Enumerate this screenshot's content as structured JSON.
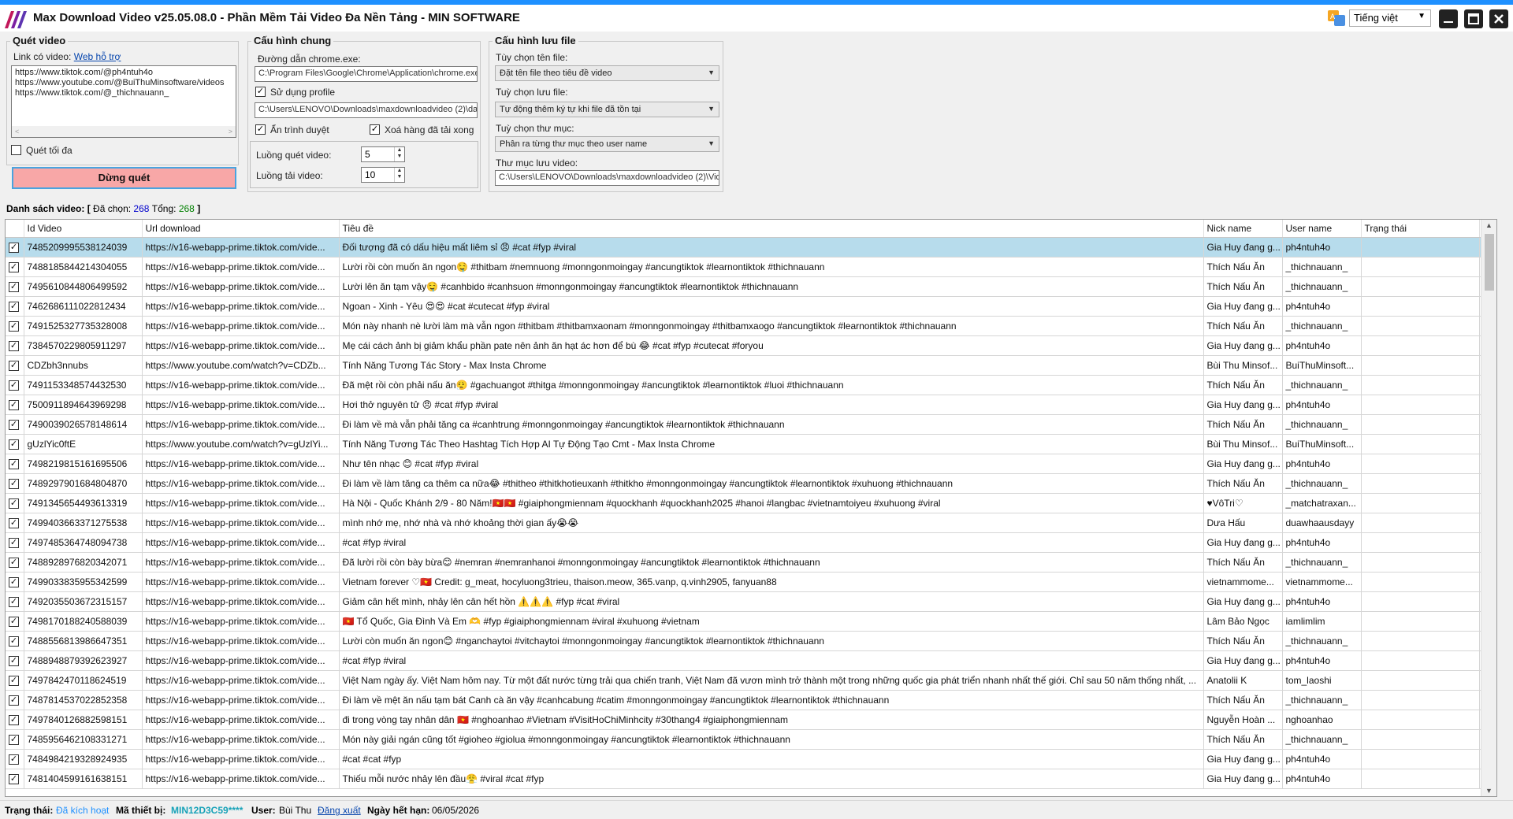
{
  "app": {
    "title": "Max Download Video v25.05.08.0 -  Phần Mềm Tải Video Đa Nền Tảng - MIN SOFTWARE",
    "language": "Tiếng việt"
  },
  "scan": {
    "title": "Quét video",
    "link_label": "Link có video:",
    "help_link": "Web hỗ trợ",
    "links": [
      "https://www.tiktok.com/@ph4ntuh4o",
      "https://www.youtube.com/@BuiThuMinsoftware/videos",
      "https://www.tiktok.com/@_thichnauann_"
    ],
    "max_scan_label": "Quét tối đa",
    "stop_button": "Dừng quét"
  },
  "general": {
    "title": "Cấu hình chung",
    "chrome_path_label": "Đường dẫn chrome.exe:",
    "chrome_path": "C:\\Program Files\\Google\\Chrome\\Application\\chrome.exe",
    "use_profile_label": "Sử dụng profile",
    "profile_path": "C:\\Users\\LENOVO\\Downloads\\maxdownloadvideo (2)\\dat",
    "hide_browser_label": "Ẩn trình duyệt",
    "delete_rows_label": "Xoá hàng đã tải xong",
    "scan_threads_label": "Luồng quét video:",
    "scan_threads": "5",
    "download_threads_label": "Luồng tải video:",
    "download_threads": "10"
  },
  "save": {
    "title": "Cấu hình lưu file",
    "filename_label": "Tùy chọn tên file:",
    "filename_value": "Đặt tên file theo tiêu đề video",
    "savefile_label": "Tuỳ chọn lưu file:",
    "savefile_value": "Tự động thêm ký tự khi file đã tồn tại",
    "folder_option_label": "Tuỳ chọn thư mục:",
    "folder_option_value": "Phân ra từng thư mục theo user name",
    "folder_label": "Thư mục lưu video:",
    "folder_value": "C:\\Users\\LENOVO\\Downloads\\maxdownloadvideo (2)\\Vid"
  },
  "list": {
    "label": "Danh sách video:",
    "open": "[",
    "selected_label": "Đã chọn:",
    "selected": "268",
    "total_label": "Tổng:",
    "total": "268",
    "close": "]"
  },
  "columns": {
    "id": "Id Video",
    "url": "Url download",
    "title": "Tiêu đề",
    "nick": "Nick name",
    "user": "User name",
    "status": "Trạng thái"
  },
  "rows": [
    {
      "id": "7485209995538124039",
      "url": "https://v16-webapp-prime.tiktok.com/vide...",
      "title": "Đối tượng đã có dấu hiệu mất liêm sỉ 😠 #cat #fyp #viral",
      "nick": "Gia Huy đang g...",
      "user": "ph4ntuh4o"
    },
    {
      "id": "7488185844214304055",
      "url": "https://v16-webapp-prime.tiktok.com/vide...",
      "title": "Lười rồi còn muốn ăn ngon🤤 #thitbam #nemnuong #monngonmoingay #ancungtiktok #learnontiktok #thichnauann",
      "nick": "Thích Nấu Ăn",
      "user": "_thichnauann_"
    },
    {
      "id": "7495610844806499592",
      "url": "https://v16-webapp-prime.tiktok.com/vide...",
      "title": "Lười lên ăn tạm vậy🤤 #canhbido #canhsuon #monngonmoingay #ancungtiktok #learnontiktok #thichnauann",
      "nick": "Thích Nấu Ăn",
      "user": "_thichnauann_"
    },
    {
      "id": "7462686111022812434",
      "url": "https://v16-webapp-prime.tiktok.com/vide...",
      "title": "Ngoan - Xinh - Yêu 😍😍 #cat #cutecat #fyp #viral",
      "nick": "Gia Huy đang g...",
      "user": "ph4ntuh4o"
    },
    {
      "id": "7491525327735328008",
      "url": "https://v16-webapp-prime.tiktok.com/vide...",
      "title": "Món này nhanh nè lười làm mà vẫn ngon #thitbam #thitbamxaonam #monngonmoingay #thitbamxaogo #ancungtiktok #learnontiktok #thichnauann",
      "nick": "Thích Nấu Ăn",
      "user": "_thichnauann_"
    },
    {
      "id": "7384570229805911297",
      "url": "https://v16-webapp-prime.tiktok.com/vide...",
      "title": "Mẹ cái cách ảnh bị giảm khẩu phần pate nên ảnh ăn hạt ác hơn để bù 😂 #cat #fyp #cutecat #foryou",
      "nick": "Gia Huy đang g...",
      "user": "ph4ntuh4o"
    },
    {
      "id": "CDZbh3nnubs",
      "url": "https://www.youtube.com/watch?v=CDZb...",
      "title": "Tính Năng Tương Tác Story - Max Insta Chrome",
      "nick": "Bùi Thu Minsof...",
      "user": "BuiThuMinsoft..."
    },
    {
      "id": "7491153348574432530",
      "url": "https://v16-webapp-prime.tiktok.com/vide...",
      "title": "Đã mệt rồi còn phải nấu ăn😮‍💨 #gachuangot #thitga #monngonmoingay #ancungtiktok #learnontiktok #luoi #thichnauann",
      "nick": "Thích Nấu Ăn",
      "user": "_thichnauann_"
    },
    {
      "id": "7500911894643969298",
      "url": "https://v16-webapp-prime.tiktok.com/vide...",
      "title": "Hơi thở nguyên tử 😠 #cat #fyp #viral",
      "nick": "Gia Huy đang g...",
      "user": "ph4ntuh4o"
    },
    {
      "id": "7490039026578148614",
      "url": "https://v16-webapp-prime.tiktok.com/vide...",
      "title": "Đi làm về mà vẫn phải tăng ca #canhtrung #monngonmoingay #ancungtiktok #learnontiktok #thichnauann",
      "nick": "Thích Nấu Ăn",
      "user": "_thichnauann_"
    },
    {
      "id": "gUzlYic0ftE",
      "url": "https://www.youtube.com/watch?v=gUzlYi...",
      "title": "Tính Năng Tương Tác Theo Hashtag Tích Hợp AI Tự Động Tạo Cmt - Max Insta Chrome",
      "nick": "Bùi Thu Minsof...",
      "user": "BuiThuMinsoft..."
    },
    {
      "id": "7498219815161695506",
      "url": "https://v16-webapp-prime.tiktok.com/vide...",
      "title": "Như tên nhạc 😊 #cat #fyp #viral",
      "nick": "Gia Huy đang g...",
      "user": "ph4ntuh4o"
    },
    {
      "id": "7489297901684804870",
      "url": "https://v16-webapp-prime.tiktok.com/vide...",
      "title": "Đi làm về làm tăng ca thêm ca nữa😂 #thitheo #thitkhotieuxanh #thitkho #monngonmoingay #ancungtiktok #learnontiktok #xuhuong #thichnauann",
      "nick": "Thích Nấu Ăn",
      "user": "_thichnauann_"
    },
    {
      "id": "7491345654493613319",
      "url": "https://v16-webapp-prime.tiktok.com/vide...",
      "title": "Hà Nội - Quốc Khánh 2/9 - 80 Năm!🇻🇳🇻🇳 #giaiphongmiennam #quockhanh #quockhanh2025 #hanoi #langbac #vietnamtoiyeu #xuhuong #viral",
      "nick": "♥VôTri♡",
      "user": "_matchatraxan..."
    },
    {
      "id": "7499403663371275538",
      "url": "https://v16-webapp-prime.tiktok.com/vide...",
      "title": "mình nhớ mẹ, nhớ nhà và nhớ khoảng thời gian ấy😭😭",
      "nick": "Dưa Hấu",
      "user": "duawhaausdayy"
    },
    {
      "id": "7497485364748094738",
      "url": "https://v16-webapp-prime.tiktok.com/vide...",
      "title": "#cat #fyp #viral",
      "nick": "Gia Huy đang g...",
      "user": "ph4ntuh4o"
    },
    {
      "id": "7488928976820342071",
      "url": "https://v16-webapp-prime.tiktok.com/vide...",
      "title": "Đã lười rồi còn bày bừa😊 #nemran #nemranhanoi #monngonmoingay #ancungtiktok #learnontiktok #thichnauann",
      "nick": "Thích Nấu Ăn",
      "user": "_thichnauann_"
    },
    {
      "id": "7499033835955342599",
      "url": "https://v16-webapp-prime.tiktok.com/vide...",
      "title": "Vietnam forever ♡🇻🇳 Credit: g_meat, hocyluong3trieu, thaison.meow, 365.vanp, q.vinh2905, fanyuan88",
      "nick": "vietnammome...",
      "user": "vietnammome..."
    },
    {
      "id": "7492035503672315157",
      "url": "https://v16-webapp-prime.tiktok.com/vide...",
      "title": "Giảm cân hết mình, nhảy lên cân hết hồn ⚠️⚠️⚠️ #fyp #cat #viral",
      "nick": "Gia Huy đang g...",
      "user": "ph4ntuh4o"
    },
    {
      "id": "7498170188240588039",
      "url": "https://v16-webapp-prime.tiktok.com/vide...",
      "title": "🇻🇳 Tổ Quốc, Gia Đình Và Em 🫶 #fyp #giaiphongmiennam #viral #xuhuong #vietnam",
      "nick": "Lâm Bảo Ngọc",
      "user": "iamlimlim"
    },
    {
      "id": "7488556813986647351",
      "url": "https://v16-webapp-prime.tiktok.com/vide...",
      "title": "Lười còn muốn ăn ngon😊 #nganchaytoi #vitchaytoi #monngonmoingay #ancungtiktok #learnontiktok #thichnauann",
      "nick": "Thích Nấu Ăn",
      "user": "_thichnauann_"
    },
    {
      "id": "7488948879392623927",
      "url": "https://v16-webapp-prime.tiktok.com/vide...",
      "title": "#cat #fyp #viral",
      "nick": "Gia Huy đang g...",
      "user": "ph4ntuh4o"
    },
    {
      "id": "7497842470118624519",
      "url": "https://v16-webapp-prime.tiktok.com/vide...",
      "title": "Việt Nam ngày ấy. Việt Nam hôm nay. Từ một đất nước từng trải qua chiến tranh, Việt Nam đã vươn mình trở thành một trong những quốc gia phát triển nhanh nhất thế giới. Chỉ sau 50 năm thống nhất, ...",
      "nick": "Anatolii K",
      "user": "tom_laoshi"
    },
    {
      "id": "7487814537022852358",
      "url": "https://v16-webapp-prime.tiktok.com/vide...",
      "title": "Đi làm về mệt ăn nấu tạm bát Canh cà ăn vậy #canhcabung #catim #monngonmoingay #ancungtiktok #learnontiktok #thichnauann",
      "nick": "Thích Nấu Ăn",
      "user": "_thichnauann_"
    },
    {
      "id": "7497840126882598151",
      "url": "https://v16-webapp-prime.tiktok.com/vide...",
      "title": "đi trong vòng tay nhân dân 🇻🇳 #nghoanhao #Vietnam #VisitHoChiMinhcity #30thang4 #giaiphongmiennam",
      "nick": "Nguyễn Hoàn ...",
      "user": "nghoanhao"
    },
    {
      "id": "7485956462108331271",
      "url": "https://v16-webapp-prime.tiktok.com/vide...",
      "title": "Món này giải ngán cũng tốt #gioheo #giolua #monngonmoingay #ancungtiktok #learnontiktok #thichnauann",
      "nick": "Thích Nấu Ăn",
      "user": "_thichnauann_"
    },
    {
      "id": "7484984219328924935",
      "url": "https://v16-webapp-prime.tiktok.com/vide...",
      "title": "#cat #cat #fyp",
      "nick": "Gia Huy đang g...",
      "user": "ph4ntuh4o"
    },
    {
      "id": "7481404599161638151",
      "url": "https://v16-webapp-prime.tiktok.com/vide...",
      "title": "Thiếu mỗi nước nhảy lên đầu😤 #viral #cat #fyp",
      "nick": "Gia Huy đang g...",
      "user": "ph4ntuh4o"
    }
  ],
  "status": {
    "status_label": "Trạng thái:",
    "status_value": "Đã kích hoạt",
    "device_label": "Mã thiết bị:",
    "device_value": "MIN12D3C59****",
    "user_label": "User:",
    "user_value": "Bùi Thu",
    "logout": "Đăng xuất",
    "expiry_label": "Ngày hết hạn:",
    "expiry_value": "06/05/2026"
  },
  "colors": {
    "accent": "#1e90ff",
    "stop_button": "#f8a7a7",
    "selected_row": "#b7dcec",
    "delete_icon": "#e01010",
    "status_ok": "#1e90ff",
    "device_id": "#17a2b8"
  }
}
